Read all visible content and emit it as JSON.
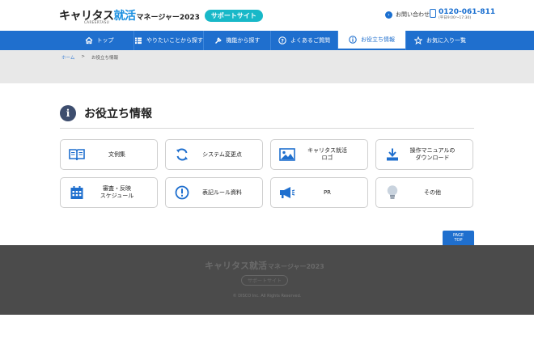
{
  "header": {
    "logo_main": "キャリタス",
    "logo_accent": "就活",
    "logo_sub": "マネージャー2023",
    "logo_badge": "サポートサイト",
    "logo_tag": "CAREERTASU",
    "contact_label": "お問い合わせ",
    "phone_number": "0120-061-811",
    "phone_hours": "(平日9:00〜17:30)"
  },
  "nav": {
    "items": [
      {
        "label": "トップ",
        "icon": "home-icon"
      },
      {
        "label": "やりたいことから探す",
        "icon": "list-icon"
      },
      {
        "label": "機能から探す",
        "icon": "wrench-icon"
      },
      {
        "label": "よくあるご質問",
        "icon": "question-icon"
      },
      {
        "label": "お役立ち情報",
        "icon": "info-icon"
      },
      {
        "label": "お気に入り一覧",
        "icon": "star-icon"
      }
    ],
    "active_index": 4
  },
  "breadcrumb": {
    "home": "ホーム",
    "separator": ">",
    "current": "お役立ち情報"
  },
  "page": {
    "title": "お役立ち情報",
    "title_icon": "i"
  },
  "tiles": [
    {
      "label": "文例集",
      "icon": "book-icon"
    },
    {
      "label": "システム変更点",
      "icon": "refresh-icon"
    },
    {
      "label": "キャリタス就活\nロゴ",
      "icon": "image-icon"
    },
    {
      "label": "操作マニュアルの\nダウンロード",
      "icon": "download-icon"
    },
    {
      "label": "審査・反映\nスケジュール",
      "icon": "calendar-icon"
    },
    {
      "label": "表記ルール資料",
      "icon": "alert-icon"
    },
    {
      "label": "PR",
      "icon": "megaphone-icon"
    },
    {
      "label": "その他",
      "icon": "lightbulb-icon"
    }
  ],
  "pagetop_label": "PAGE\nTOP",
  "footer": {
    "logo_main": "キャリタス就活",
    "logo_sub": "マネージャー2023",
    "badge": "サポートサイト",
    "copyright": "© DISCO Inc. All Rights Reserved."
  },
  "colors": {
    "brand_blue": "#1f6fce",
    "accent_cyan": "#18b8c8",
    "footer_bg": "#4b4b4b"
  }
}
